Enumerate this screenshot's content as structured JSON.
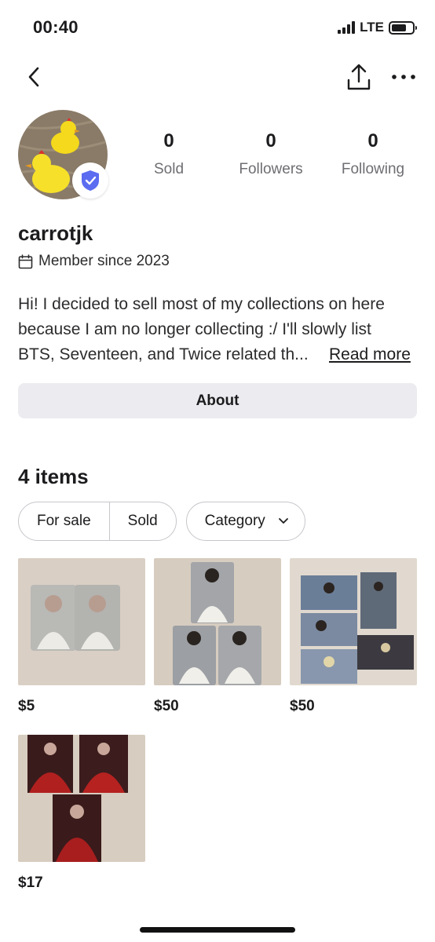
{
  "status_bar": {
    "time": "00:40",
    "network": "LTE"
  },
  "profile": {
    "username": "carrotjk",
    "member_since": "Member since 2023",
    "stats": [
      {
        "value": "0",
        "label": "Sold"
      },
      {
        "value": "0",
        "label": "Followers"
      },
      {
        "value": "0",
        "label": "Following"
      }
    ],
    "bio_lines": [
      "Hi! I decided to sell most of my collections on here",
      "because I am no longer collecting :/ I'll slowly list",
      "BTS, Seventeen, and Twice related th..."
    ],
    "read_more": "Read more",
    "about_label": "About"
  },
  "listings": {
    "title": "4 items",
    "filters": {
      "for_sale": "For sale",
      "sold": "Sold",
      "category": "Category"
    },
    "items": [
      {
        "price": "$5"
      },
      {
        "price": "$50"
      },
      {
        "price": "$50"
      },
      {
        "price": "$17"
      }
    ]
  },
  "colors": {
    "verified": "#5b6cf0",
    "chip_border": "#c7c7cc",
    "about_bg": "#ececf0"
  }
}
